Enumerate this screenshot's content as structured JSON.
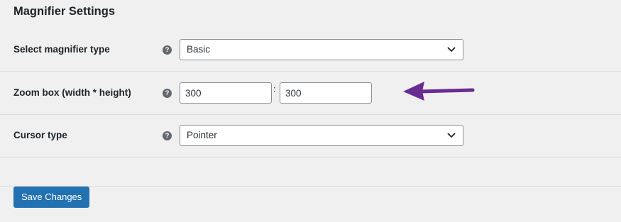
{
  "section": {
    "title": "Magnifier Settings"
  },
  "help_icon_glyph": "?",
  "settings": {
    "magnifier_type": {
      "label": "Select magnifier type",
      "selected": "Basic"
    },
    "zoom_box": {
      "label": "Zoom box (width * height)",
      "width": "300",
      "height": "300",
      "separator": ":"
    },
    "cursor_type": {
      "label": "Cursor type",
      "selected": "Pointer"
    }
  },
  "actions": {
    "save_label": "Save Changes"
  },
  "colors": {
    "background": "#f0f0f1",
    "primary_button": "#2271b1",
    "annotation_arrow": "#6a2c91",
    "help_icon": "#646970"
  },
  "icons": {
    "help": "question-circle-icon",
    "dropdown": "chevron-down-icon",
    "annotation": "arrow-left-icon"
  }
}
